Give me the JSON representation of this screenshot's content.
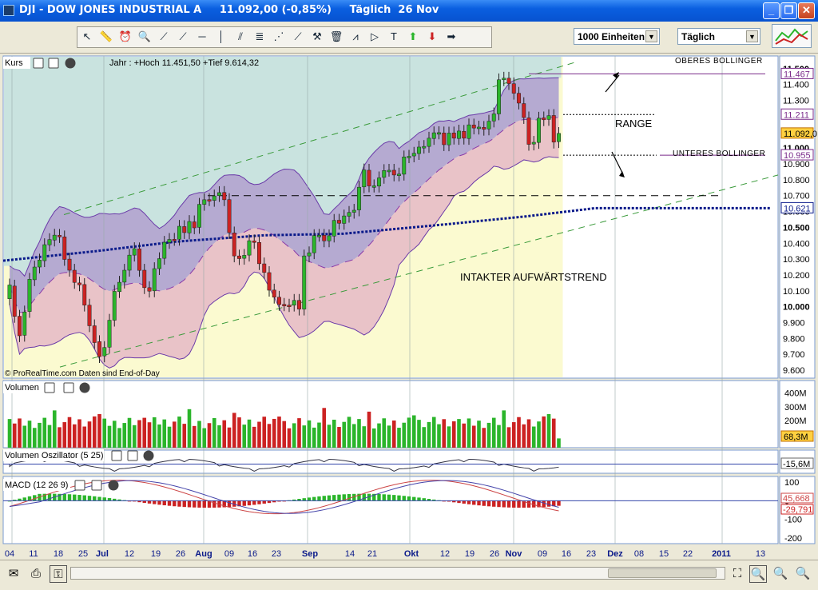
{
  "window": {
    "title": "DJI - DOW JONES INDUSTRIAL A     11.092,00 (-0,85%)     Täglich  26 Nov",
    "buttons": [
      "_",
      "❐",
      "✕"
    ]
  },
  "toolbar": {
    "units_label": "1000 Einheiten",
    "timeframe_label": "Täglich"
  },
  "colors": {
    "up_candle": "#2bb52b",
    "down_candle": "#cc2222",
    "bollinger_fill": "#9d8fd2",
    "ma200": "#0a1a8a",
    "macd_line": "#c44",
    "signal_line": "#44a"
  },
  "chart_data": [
    {
      "type": "candlestick",
      "panel_title": "Kurs",
      "header": "Jahr : +Hoch 11.451,50 +Tief 9.614,32",
      "watermark": "© ProRealTime.com  Daten sind End-of-Day",
      "ylim": [
        9550,
        11580
      ],
      "y_ticks": [
        9600,
        9700,
        9800,
        9900,
        10000,
        10100,
        10200,
        10300,
        10400,
        10500,
        10600,
        10700,
        10800,
        10900,
        11000,
        11100,
        11200,
        11300,
        11400,
        11500
      ],
      "y_tick_labels": [
        "9.600",
        "9.700",
        "9.800",
        "9.900",
        "10.000",
        "10.100",
        "10.200",
        "10.300",
        "10.400",
        "10.500",
        "10.600",
        "10.700",
        "10.800",
        "10.900",
        "11.000",
        "11.100",
        "11.200",
        "11.300",
        "11.400",
        "11.500"
      ],
      "price_tags": [
        {
          "label": "11.467",
          "value": 11467,
          "color": "#7a2a8a"
        },
        {
          "label": "11.211",
          "value": 11211,
          "color": "#7a2a8a"
        },
        {
          "label": "11.092,0",
          "value": 11092,
          "color": "#c07000"
        },
        {
          "label": "10.955",
          "value": 10955,
          "color": "#7a2a8a"
        },
        {
          "label": "10.621",
          "value": 10621,
          "color": "#0a1a8a"
        }
      ],
      "annotations": {
        "upper_bollinger": "OBERES BOLLINGER",
        "lower_bollinger": "UNTERES BOLLINGER",
        "range": "RANGE",
        "trend": "INTAKTER AUFWÄRTSTREND"
      },
      "levels": {
        "upper_bollinger": 11467,
        "range_top": 11211,
        "range_bottom": 10955,
        "support": 10700,
        "ma200": 10621
      },
      "close": [
        10137,
        9939,
        9817,
        9967,
        10173,
        10250,
        10294,
        10391,
        10423,
        10451,
        10442,
        10298,
        10230,
        10153,
        10138,
        10010,
        9880,
        9774,
        9686,
        9743,
        9915,
        10097,
        10154,
        10230,
        10325,
        10366,
        10229,
        10120,
        10098,
        10240,
        10303,
        10406,
        10424,
        10424,
        10507,
        10467,
        10537,
        10497,
        10645,
        10674,
        10674,
        10698,
        10719,
        10674,
        10467,
        10320,
        10303,
        10324,
        10416,
        10405,
        10271,
        10216,
        10104,
        10060,
        10014,
        10012,
        10007,
        10040,
        9985,
        10320,
        10340,
        10448,
        10450,
        10415,
        10447,
        10544,
        10526,
        10572,
        10594,
        10608,
        10753,
        10862,
        10761,
        10762,
        10812,
        10858,
        10860,
        10830,
        10836,
        10944,
        10948,
        10967,
        11006,
        11010,
        11062,
        11096,
        11097,
        11021,
        11094,
        11062,
        11107,
        11062,
        11146,
        11126,
        11132,
        11118,
        11169,
        11215,
        11430,
        11440,
        11406,
        11345,
        11283,
        11192,
        11023,
        11036,
        11188,
        11178,
        11204,
        11037,
        11092
      ],
      "open": [
        10050,
        10130,
        9940,
        9820,
        9970,
        10170,
        10250,
        10290,
        10390,
        10420,
        10450,
        10440,
        10300,
        10230,
        10150,
        10140,
        10010,
        9880,
        9780,
        9690,
        9745,
        9915,
        10095,
        10155,
        10230,
        10325,
        10365,
        10230,
        10120,
        10100,
        10240,
        10305,
        10405,
        10425,
        10425,
        10505,
        10465,
        10535,
        10500,
        10645,
        10675,
        10670,
        10700,
        10720,
        10675,
        10465,
        10320,
        10305,
        10325,
        10415,
        10405,
        10270,
        10215,
        10105,
        10060,
        10015,
        10010,
        10010,
        10040,
        9985,
        10320,
        10340,
        10450,
        10450,
        10415,
        10445,
        10545,
        10525,
        10570,
        10595,
        10610,
        10755,
        10860,
        10760,
        10760,
        10815,
        10860,
        10860,
        10830,
        10835,
        10945,
        10950,
        10965,
        11005,
        11010,
        11060,
        11095,
        11095,
        11020,
        11095,
        11060,
        11105,
        11060,
        11145,
        11125,
        11130,
        11120,
        11170,
        11215,
        11430,
        11440,
        11405,
        11345,
        11280,
        11190,
        11025,
        11035,
        11190,
        11180,
        11205,
        11040
      ],
      "volume_panel": {
        "title": "Volumen",
        "ylim": [
          0,
          480
        ],
        "y_ticks": [
          100,
          200,
          300,
          400
        ],
        "y_tick_labels": [
          "100M",
          "200M",
          "300M",
          "400M"
        ],
        "last_label": "68,3M"
      },
      "oscillator_panel": {
        "title": "Volumen Oszillator (5 25)",
        "last_label": "-15,6M"
      },
      "macd_panel": {
        "title": "MACD (12 26 9)",
        "ylim": [
          -230,
          130
        ],
        "y_ticks": [
          100,
          0,
          -100,
          -200
        ],
        "y_tick_labels": [
          "100",
          "0",
          "-100",
          "-200"
        ],
        "last_macd_label": "45,668",
        "last_hist_label": "-29,791"
      },
      "x_tick_labels": [
        "04",
        "11",
        "18",
        "25",
        "Jul",
        "12",
        "19",
        "26",
        "Aug",
        "09",
        "16",
        "23",
        "Sep",
        "14",
        "21",
        "Okt",
        "12",
        "19",
        "26",
        "Nov",
        "09",
        "16",
        "23",
        "Dez",
        "08",
        "15",
        "22",
        "2011",
        "13"
      ]
    }
  ]
}
